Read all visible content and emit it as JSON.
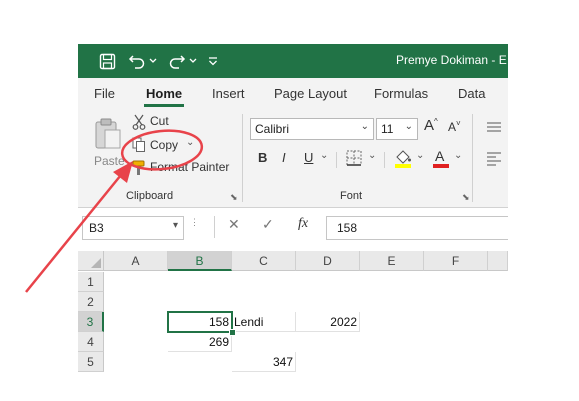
{
  "title_bar": {
    "document_title": "Premye Dokiman - E",
    "save_icon": "save-icon",
    "undo_icon": "undo-icon",
    "redo_icon": "redo-icon",
    "customize_icon": "customize-toolbar-icon"
  },
  "tabs": [
    {
      "label": "File"
    },
    {
      "label": "Home",
      "active": true
    },
    {
      "label": "Insert"
    },
    {
      "label": "Page Layout"
    },
    {
      "label": "Formulas"
    },
    {
      "label": "Data"
    }
  ],
  "ribbon": {
    "clipboard": {
      "paste_label": "Paste",
      "cut_label": "Cut",
      "copy_label": "Copy",
      "format_painter_label": "Format Painter",
      "group_label": "Clipboard"
    },
    "font": {
      "font_name": "Calibri",
      "font_size": "11",
      "bold_label": "B",
      "italic_label": "I",
      "underline_label": "U",
      "group_label": "Font",
      "highlight_color": "#ffff00",
      "font_color": "#e02020"
    }
  },
  "formula_bar": {
    "name_box": "B3",
    "cancel_symbol": "✕",
    "enter_symbol": "✓",
    "fx_label": "fx",
    "value": "158"
  },
  "sheet": {
    "columns": [
      "A",
      "B",
      "C",
      "D",
      "E",
      "F"
    ],
    "rows": [
      "1",
      "2",
      "3",
      "4",
      "5"
    ],
    "cells": {
      "B3": "158",
      "C3": "Lendi",
      "D3": "2022",
      "B4": "269",
      "C5": "347"
    },
    "selected_cell": "B3"
  },
  "colors": {
    "accent": "#217346",
    "annotation": "#e8434a"
  }
}
